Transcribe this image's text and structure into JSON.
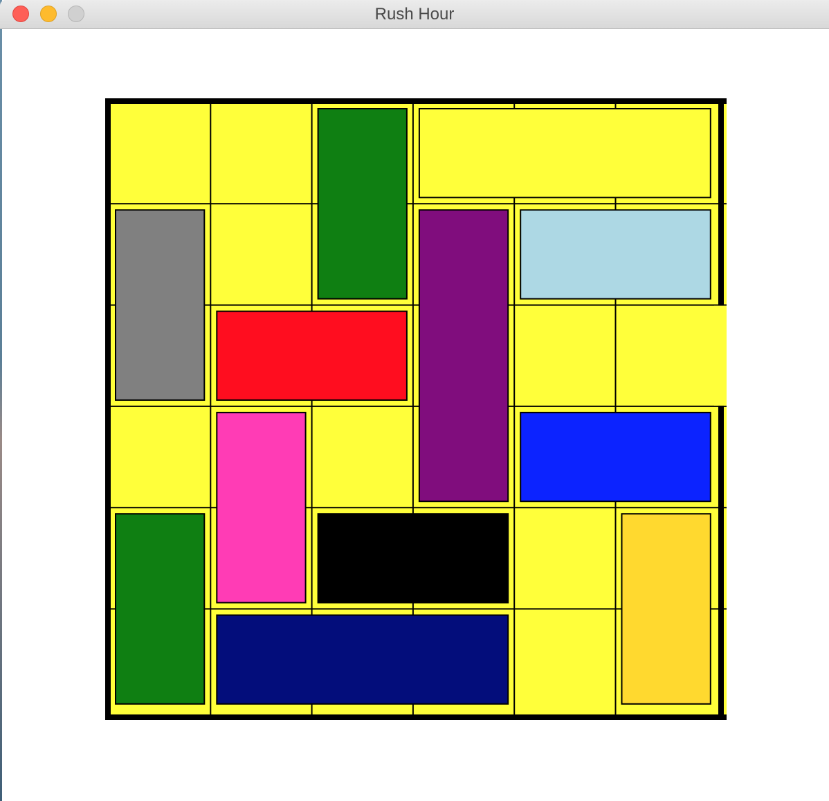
{
  "window": {
    "title": "Rush Hour",
    "controls": [
      "close",
      "minimize",
      "zoom"
    ]
  },
  "game": {
    "grid": {
      "rows": 6,
      "cols": 6
    },
    "exit": {
      "row": 2,
      "side": "right"
    },
    "colors": {
      "board": "#ffff3a",
      "grid_line": "#000000",
      "frame": "#000000"
    },
    "vehicles": [
      {
        "id": "green-top",
        "row": 0,
        "col": 2,
        "length": 2,
        "orientation": "vertical",
        "color": "#0f7f12"
      },
      {
        "id": "yellow-top",
        "row": 0,
        "col": 3,
        "length": 3,
        "orientation": "horizontal",
        "color": "#ffff3a"
      },
      {
        "id": "gray",
        "row": 1,
        "col": 0,
        "length": 2,
        "orientation": "vertical",
        "color": "#808080"
      },
      {
        "id": "purple",
        "row": 1,
        "col": 3,
        "length": 3,
        "orientation": "vertical",
        "color": "#800d7d"
      },
      {
        "id": "light-blue",
        "row": 1,
        "col": 4,
        "length": 2,
        "orientation": "horizontal",
        "color": "#add8e4"
      },
      {
        "id": "red",
        "row": 2,
        "col": 1,
        "length": 2,
        "orientation": "horizontal",
        "color": "#ff0d1f"
      },
      {
        "id": "pink",
        "row": 3,
        "col": 1,
        "length": 2,
        "orientation": "vertical",
        "color": "#ff3cb5"
      },
      {
        "id": "blue",
        "row": 3,
        "col": 4,
        "length": 2,
        "orientation": "horizontal",
        "color": "#0c23ff"
      },
      {
        "id": "green-bottom",
        "row": 4,
        "col": 0,
        "length": 2,
        "orientation": "vertical",
        "color": "#0f7f12"
      },
      {
        "id": "black",
        "row": 4,
        "col": 2,
        "length": 2,
        "orientation": "horizontal",
        "color": "#000000"
      },
      {
        "id": "gold",
        "row": 4,
        "col": 5,
        "length": 2,
        "orientation": "vertical",
        "color": "#ffd92f"
      },
      {
        "id": "navy",
        "row": 5,
        "col": 1,
        "length": 3,
        "orientation": "horizontal",
        "color": "#030d7b"
      }
    ]
  }
}
